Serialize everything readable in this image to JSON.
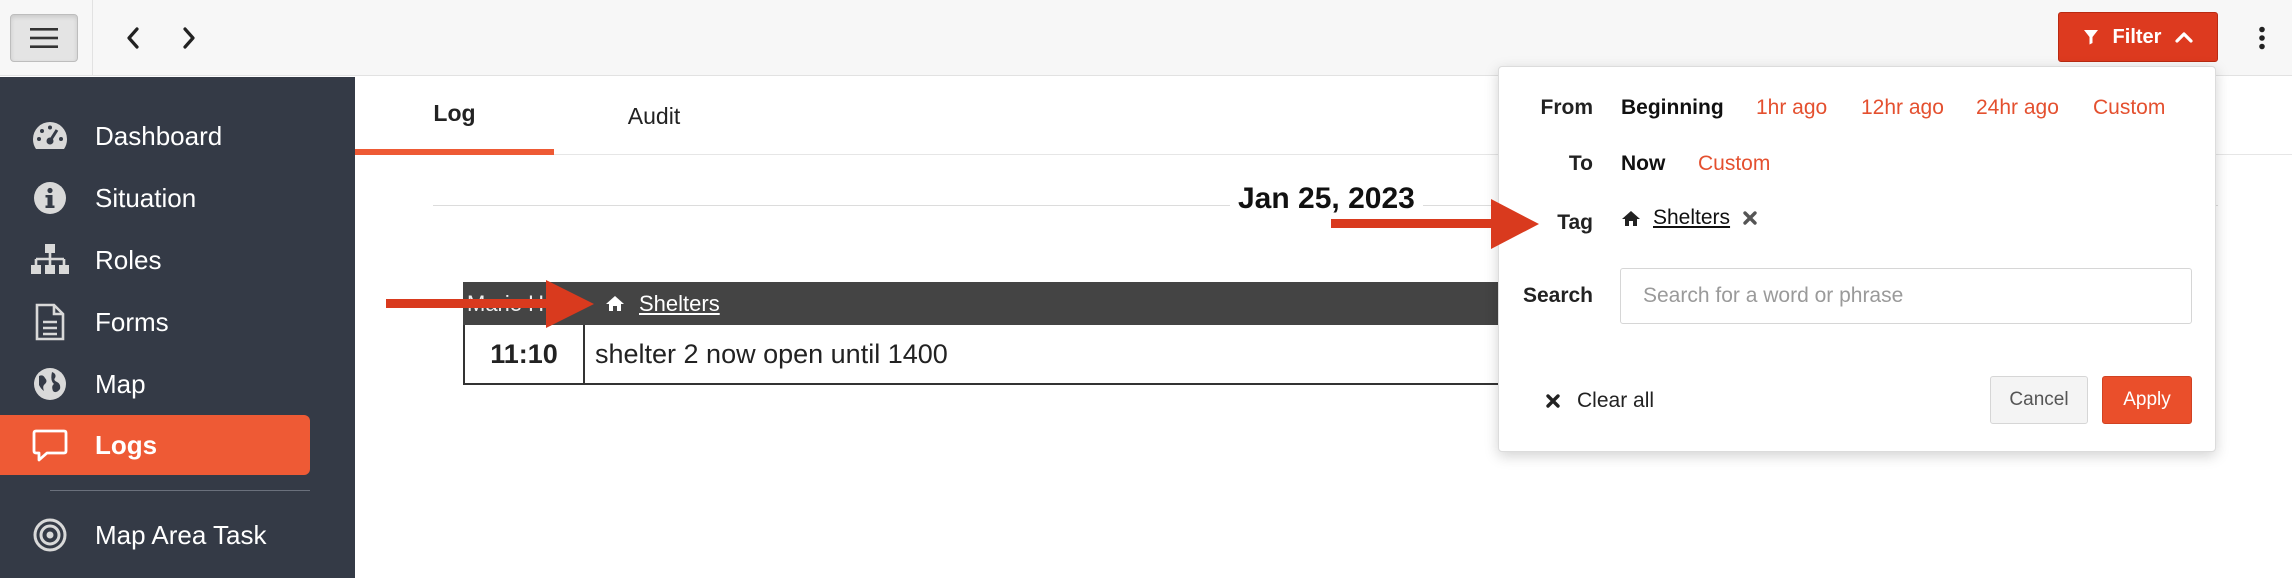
{
  "topbar": {
    "menu_icon": "hamburger-icon",
    "back_icon": "chevron-left-icon",
    "forward_icon": "chevron-right-icon",
    "filter_label": "Filter",
    "filter_icon": "funnel-icon",
    "filter_caret_icon": "chevron-up-icon",
    "more_icon": "kebab-vertical-icon"
  },
  "sidebar": {
    "items": [
      {
        "label": "Dashboard",
        "icon": "dashboard-gauge-icon"
      },
      {
        "label": "Situation",
        "icon": "info-circle-icon"
      },
      {
        "label": "Roles",
        "icon": "org-chart-icon"
      },
      {
        "label": "Forms",
        "icon": "document-icon"
      },
      {
        "label": "Map",
        "icon": "globe-icon"
      },
      {
        "label": "Logs",
        "icon": "chat-bubble-icon",
        "active": true
      },
      {
        "label": "Map Area Task",
        "icon": "target-icon"
      }
    ]
  },
  "tabs": [
    {
      "label": "Log",
      "active": true
    },
    {
      "label": "Audit",
      "active": false
    }
  ],
  "log": {
    "date": "Jan 25, 2023",
    "entries": [
      {
        "author": "Marie H",
        "tag": "Shelters",
        "tag_icon": "home-icon",
        "time": "11:10",
        "message": "shelter 2 now open until 1400"
      }
    ]
  },
  "filter_panel": {
    "from_label": "From",
    "from_options": [
      "Beginning",
      "1hr ago",
      "12hr ago",
      "24hr ago",
      "Custom"
    ],
    "from_selected": "Beginning",
    "to_label": "To",
    "to_options": [
      "Now",
      "Custom"
    ],
    "to_selected": "Now",
    "tag_label": "Tag",
    "tag_value": "Shelters",
    "tag_icon": "home-icon",
    "tag_remove_icon": "close-x-icon",
    "search_label": "Search",
    "search_placeholder": "Search for a word or phrase",
    "search_value": "",
    "clear_all_label": "Clear all",
    "cancel_label": "Cancel",
    "apply_label": "Apply"
  },
  "colors": {
    "accent": "#ee5a35",
    "filter_button": "#dd3a1f",
    "link_option": "#e4502f",
    "sidebar_bg": "#343a46",
    "annotation_arrow": "#d93a1e"
  }
}
